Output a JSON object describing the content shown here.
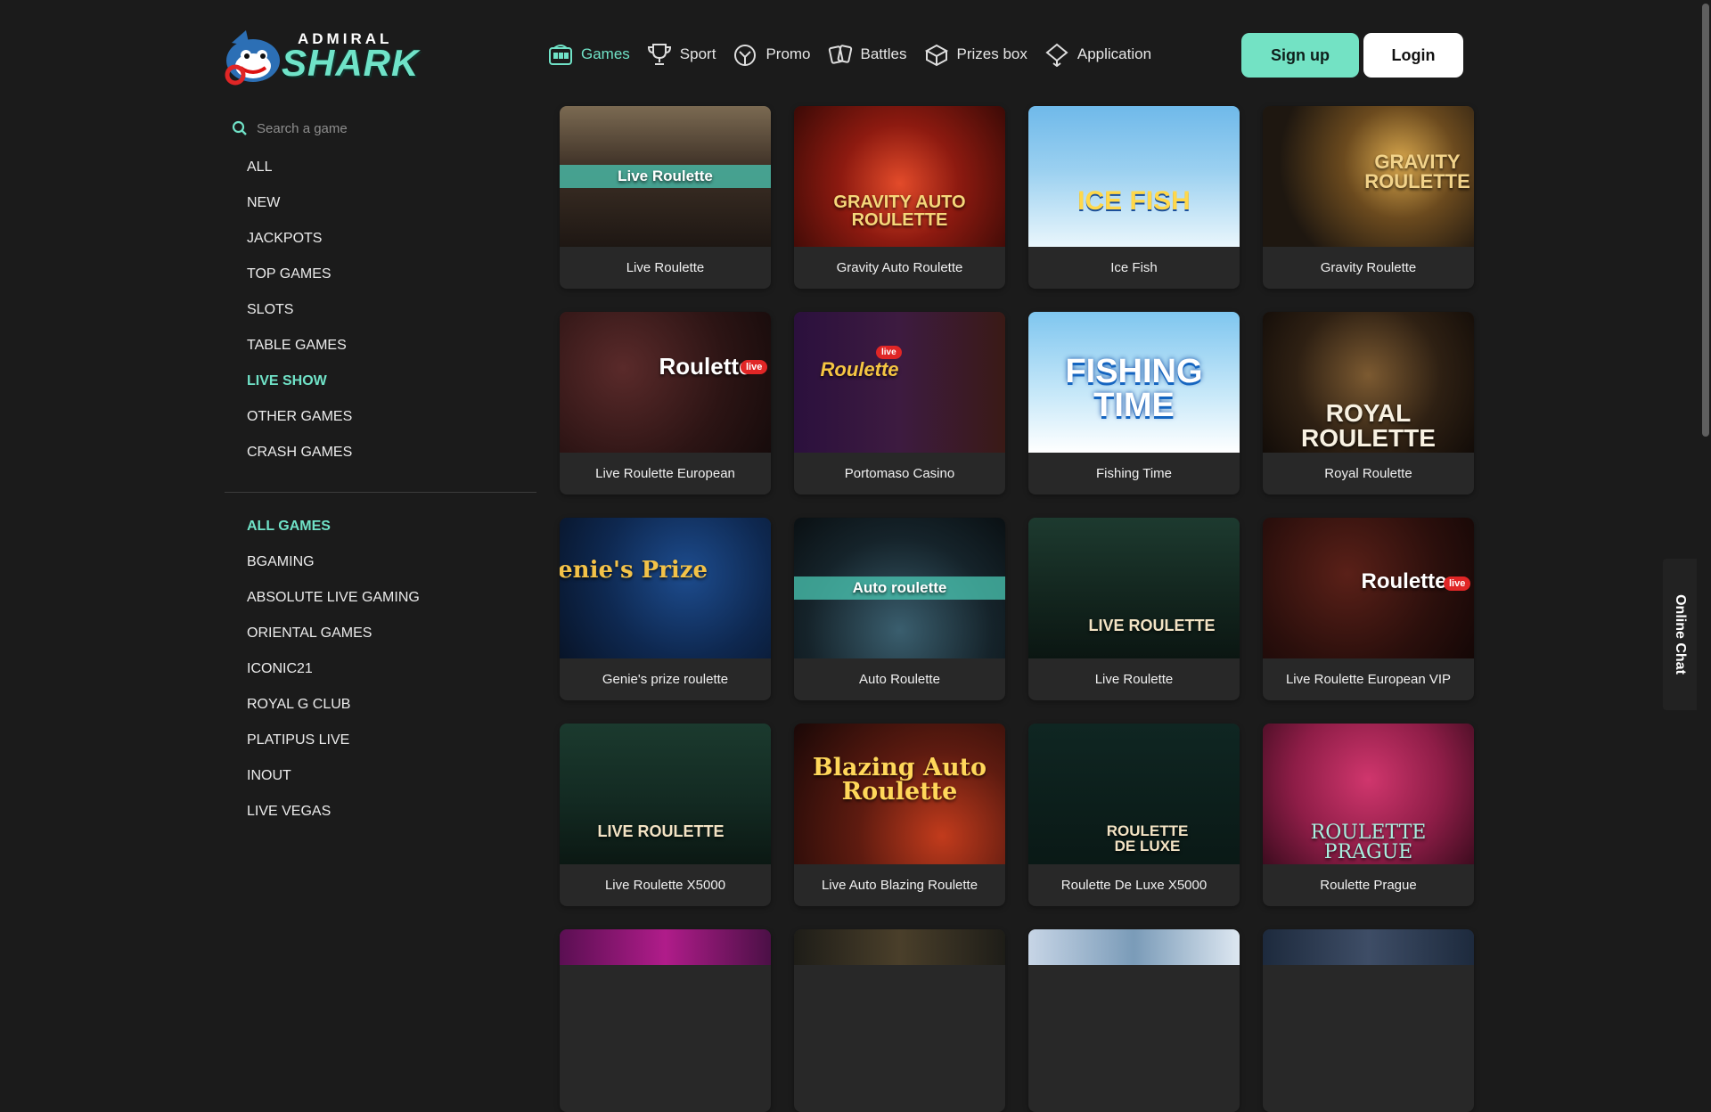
{
  "brand": {
    "top": "ADMIRAL",
    "main": "SHARK"
  },
  "nav": [
    {
      "label": "Games",
      "icon": "slot-machine-icon",
      "active": true
    },
    {
      "label": "Sport",
      "icon": "trophy-icon"
    },
    {
      "label": "Promo",
      "icon": "gift-icon"
    },
    {
      "label": "Battles",
      "icon": "battle-cards-icon"
    },
    {
      "label": "Prizes box",
      "icon": "prize-box-icon"
    },
    {
      "label": "Application",
      "icon": "app-icon"
    }
  ],
  "auth": {
    "signup": "Sign up",
    "login": "Login"
  },
  "search": {
    "placeholder": "Search a game"
  },
  "categories": [
    "ALL",
    "NEW",
    "JACKPOTS",
    "TOP GAMES",
    "SLOTS",
    "TABLE GAMES",
    "LIVE SHOW",
    "OTHER GAMES",
    "CRASH GAMES"
  ],
  "active_category": "LIVE SHOW",
  "providers": [
    "ALL GAMES",
    "BGAMING",
    "ABSOLUTE LIVE GAMING",
    "ORIENTAL GAMES",
    "ICONIC21",
    "ROYAL G CLUB",
    "PLATIPUS LIVE",
    "INOUT",
    "LIVE VEGAS"
  ],
  "active_provider": "ALL GAMES",
  "games": [
    {
      "title": "Live Roulette",
      "art": "Live Roulette"
    },
    {
      "title": "Gravity Auto Roulette",
      "art": "GRAVITY AUTO ROULETTE"
    },
    {
      "title": "Ice Fish",
      "art": "ICE FISH"
    },
    {
      "title": "Gravity Roulette",
      "art": "GRAVITY ROULETTE"
    },
    {
      "title": "Live Roulette European",
      "art": "Roulette"
    },
    {
      "title": "Portomaso Casino",
      "art": "Roulette"
    },
    {
      "title": "Fishing Time",
      "art": "FISHING TIME"
    },
    {
      "title": "Royal Roulette",
      "art": "ROYAL ROULETTE"
    },
    {
      "title": "Genie's prize roulette",
      "art": "Genie's Prize"
    },
    {
      "title": "Auto Roulette",
      "art": "Auto roulette"
    },
    {
      "title": "Live Roulette",
      "art": "LIVE ROULETTE"
    },
    {
      "title": "Live Roulette European VIP",
      "art": "Roulette"
    },
    {
      "title": "Live Roulette X5000",
      "art": "LIVE ROULETTE"
    },
    {
      "title": "Live Auto Blazing Roulette",
      "art": "Blazing Auto Roulette"
    },
    {
      "title": "Roulette De Luxe X5000",
      "art": "ROULETTE DE LUXE"
    },
    {
      "title": "Roulette Prague",
      "art": "ROULETTE PRAGUE"
    }
  ],
  "chat": {
    "label": "Online Chat"
  }
}
